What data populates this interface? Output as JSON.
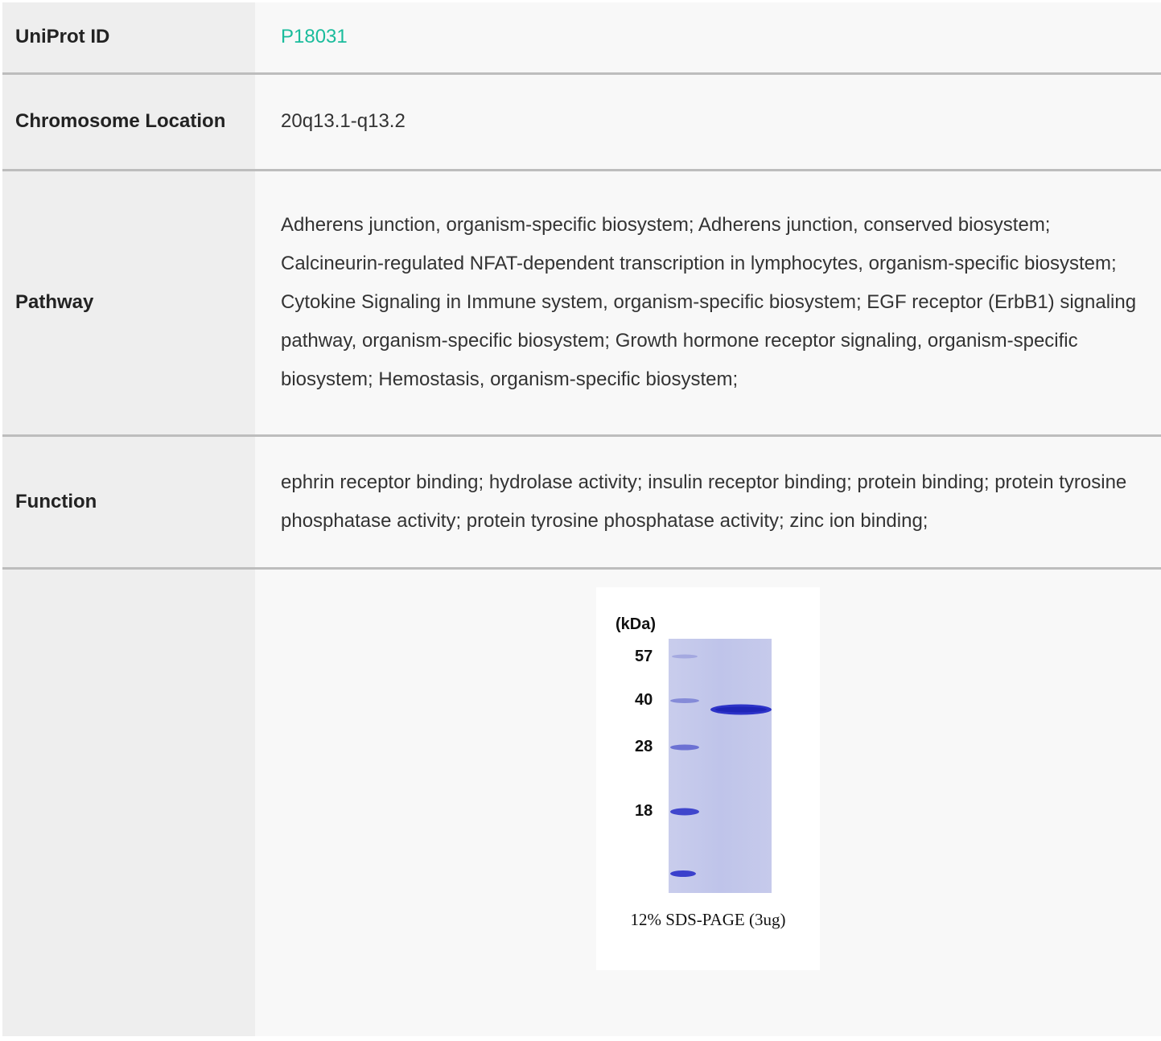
{
  "rows": {
    "uniprot": {
      "label": "UniProt ID",
      "value": "P18031"
    },
    "chromosome": {
      "label": "Chromosome Location",
      "value": "20q13.1-q13.2"
    },
    "pathway": {
      "label": "Pathway",
      "value": "Adherens junction, organism-specific biosystem; Adherens junction, conserved biosystem; Calcineurin-regulated NFAT-dependent transcription in lymphocytes, organism-specific biosystem; Cytokine Signaling in Immune system, organism-specific biosystem; EGF receptor (ErbB1) signaling pathway, organism-specific biosystem; Growth hormone receptor signaling, organism-specific biosystem; Hemostasis, organism-specific biosystem;"
    },
    "function": {
      "label": "Function",
      "value": "ephrin receptor binding; hydrolase activity; insulin receptor binding; protein binding; protein tyrosine phosphatase activity; protein tyrosine phosphatase activity; zinc ion binding;"
    }
  },
  "gel_image": {
    "unit_label": "(kDa)",
    "markers": [
      "57",
      "40",
      "28",
      "18"
    ],
    "caption": "12% SDS-PAGE (3ug)"
  },
  "colors": {
    "link": "#1abc9c",
    "label_bg": "#eeeeee",
    "value_bg": "#f8f8f8",
    "divider": "#bdbdbd",
    "gel_bg": "#c4c8ea",
    "band": "#3a3fd0"
  }
}
